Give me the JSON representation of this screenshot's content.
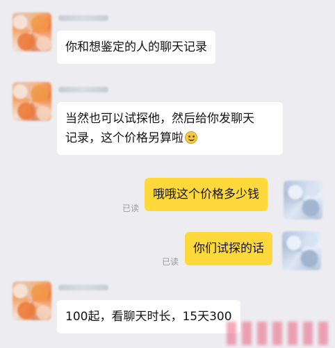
{
  "messages": [
    {
      "side": "left",
      "text": "你和想鉴定的人的聊天记录"
    },
    {
      "side": "left",
      "line1": "当然也可以试探他，然后给你发聊天",
      "line2": "记录，这个价格另算啦",
      "emoji": "smile-emoji"
    },
    {
      "side": "right",
      "text": "哦哦这个价格多少钱",
      "status": "已读"
    },
    {
      "side": "right",
      "text": "你们试探的话",
      "status": "已读"
    },
    {
      "side": "left",
      "text": "100起，看聊天时长，15天300"
    }
  ],
  "colors": {
    "background": "#ececf1",
    "incoming_bubble": "#ffffff",
    "outgoing_bubble": "#ffd93b",
    "read_status": "#9a9aa2"
  }
}
